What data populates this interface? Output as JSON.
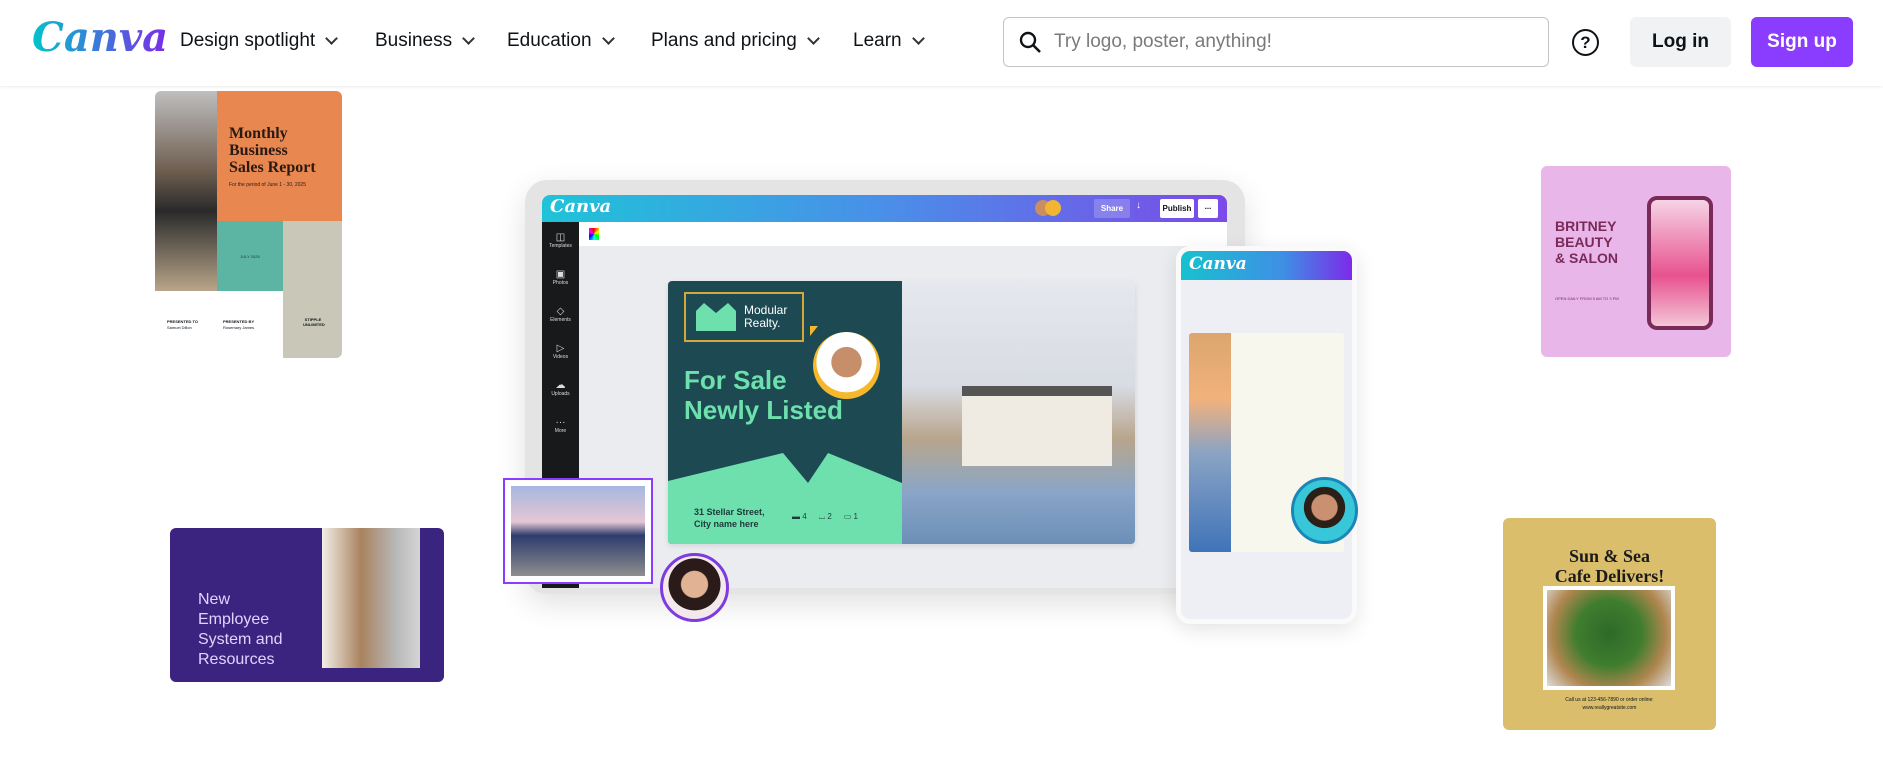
{
  "header": {
    "logo": "Canva",
    "nav": [
      {
        "label": "Design spotlight"
      },
      {
        "label": "Business"
      },
      {
        "label": "Education"
      },
      {
        "label": "Plans and pricing"
      },
      {
        "label": "Learn"
      }
    ],
    "search_placeholder": "Try logo, poster, anything!",
    "help": "?",
    "login": "Log in",
    "signup": "Sign up"
  },
  "colors": {
    "accent": "#8b3dff",
    "login_bg": "#f1f2f4"
  },
  "cards": {
    "report": {
      "title_lines": [
        "Monthly",
        "Business",
        "Sales Report"
      ],
      "subtitle": "For the period of June 1 - 30, 2025",
      "date": "JULY 2025",
      "presented_to": "PRESENTED TO",
      "presented_to_name": "Samuel Dillon",
      "presented_by": "PRESENTED BY",
      "presented_by_name": "Rosemary James",
      "brand": "STIPPLE UNLIMITED"
    },
    "employee": {
      "title_lines": [
        "New",
        "Employee",
        "System and",
        "Resources"
      ]
    },
    "salon": {
      "title_lines": [
        "BRITNEY",
        "BEAUTY",
        "& SALON"
      ],
      "hours": "OPEN DAILY FROM 9 AM TO 3 PM"
    },
    "cafe": {
      "title_lines": [
        "Sun & Sea",
        "Cafe Delivers!"
      ],
      "contact_lines": [
        "Call us at 123-456-7890 or order online:",
        "www.reallygreatsite.com"
      ]
    }
  },
  "editor": {
    "logo": "Canva",
    "share": "Share",
    "publish": "Publish",
    "more": "...",
    "sidebar": [
      {
        "label": "Templates"
      },
      {
        "label": "Photos"
      },
      {
        "label": "Elements"
      },
      {
        "label": "Videos"
      },
      {
        "label": "Uploads"
      },
      {
        "label": "More"
      }
    ],
    "design": {
      "brand_lines": [
        "Modular",
        "Realty."
      ],
      "headline_lines": [
        "For Sale",
        "Newly Listed"
      ],
      "address_lines": [
        "31 Stellar Street,",
        "City name here"
      ],
      "beds": "4",
      "baths": "2",
      "cars": "1"
    },
    "phone_logo": "Canva"
  }
}
